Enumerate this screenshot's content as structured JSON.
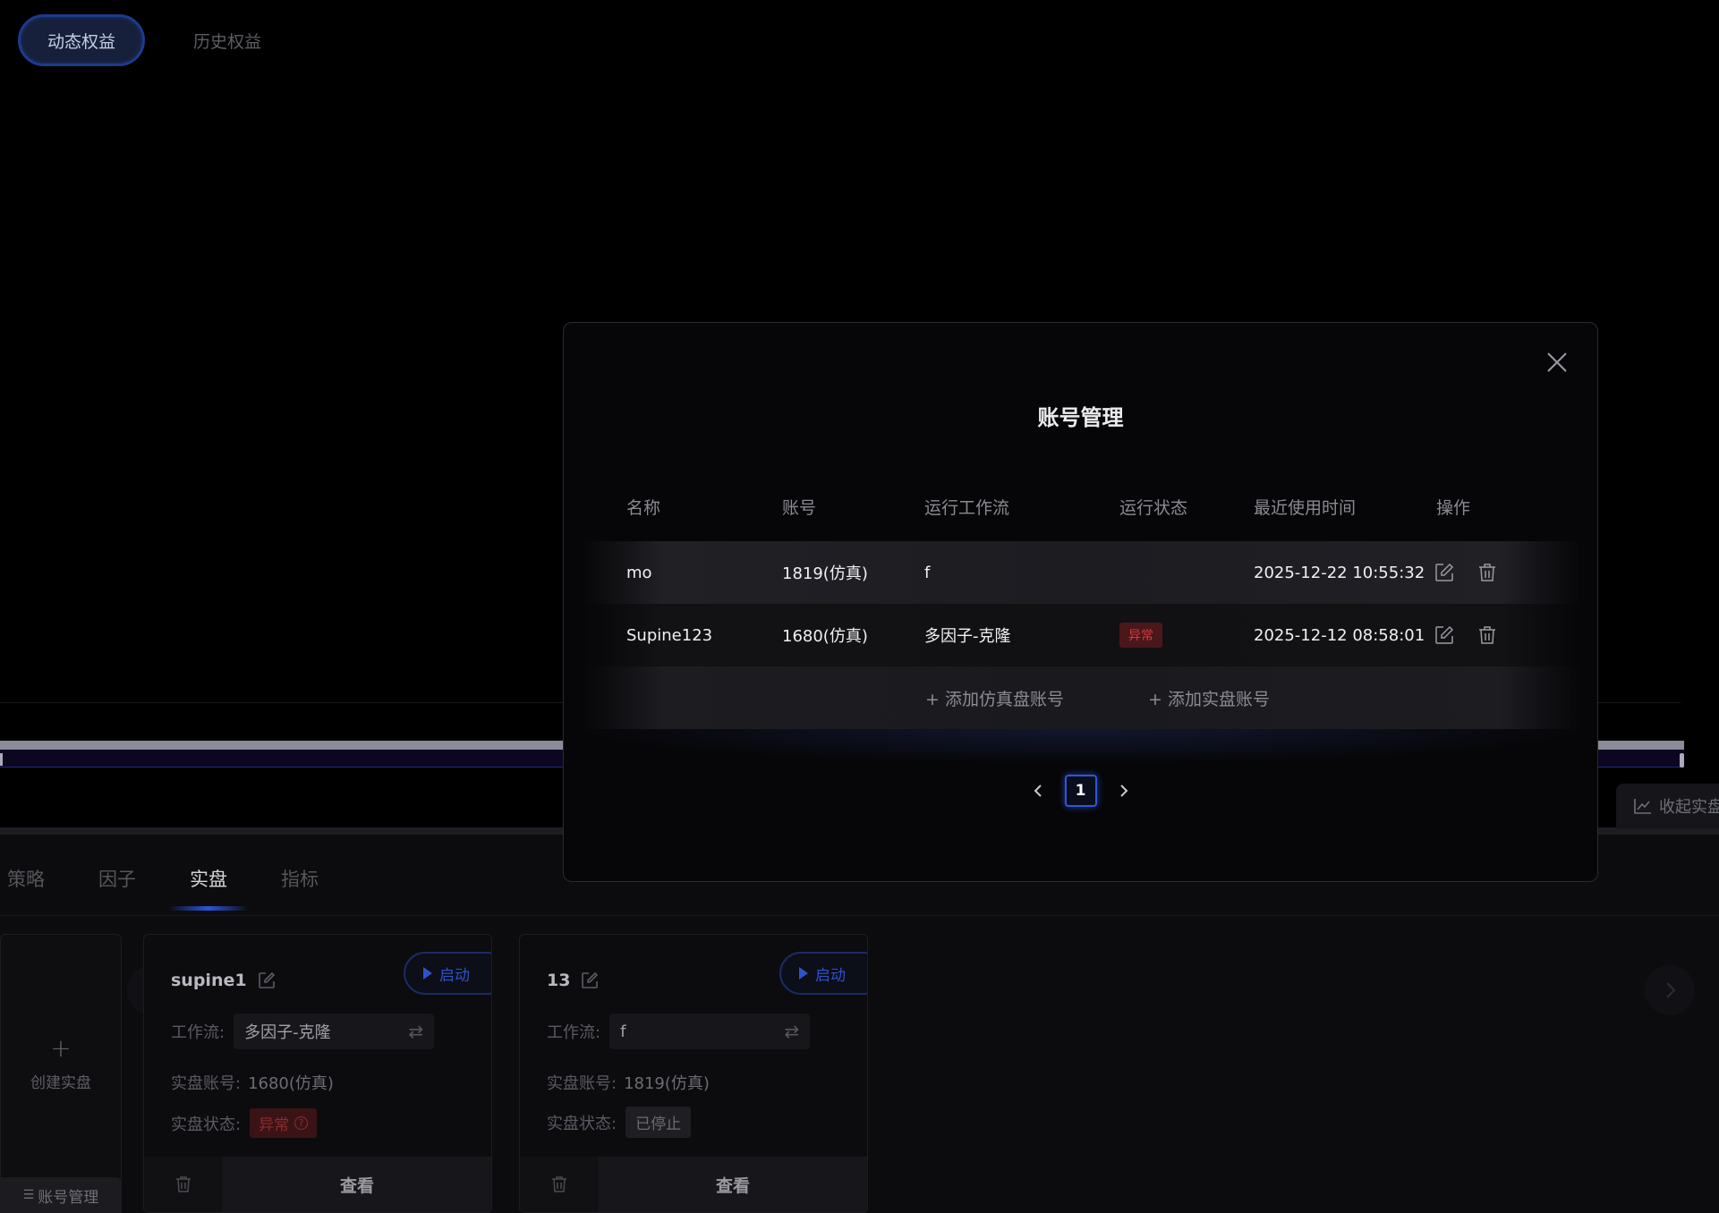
{
  "top_tabs": [
    {
      "label": "动态权益",
      "active": true
    },
    {
      "label": "历史权益",
      "active": false
    }
  ],
  "sub_tabs": [
    {
      "label": "策略",
      "active": false
    },
    {
      "label": "因子",
      "active": false
    },
    {
      "label": "实盘",
      "active": true
    },
    {
      "label": "指标",
      "active": false
    }
  ],
  "create_card": {
    "plus": "+",
    "label": "创建实盘"
  },
  "account_button": {
    "icon": "list-icon",
    "label": "账号管理"
  },
  "collapse_button": {
    "label": "收起实盘",
    "icon": "line-chart-icon"
  },
  "cards": [
    {
      "name": "supine1",
      "start_label": "启动",
      "workflow_label": "工作流:",
      "workflow_value": "多因子-克隆",
      "account_label": "实盘账号:",
      "account_value": "1680(仿真)",
      "status_label": "实盘状态:",
      "status_value": "异常",
      "status_type": "error",
      "view_label": "查看"
    },
    {
      "name": "13",
      "start_label": "启动",
      "workflow_label": "工作流:",
      "workflow_value": "f",
      "account_label": "实盘账号:",
      "account_value": "1819(仿真)",
      "status_label": "实盘状态:",
      "status_value": "已停止",
      "status_type": "stopped",
      "view_label": "查看"
    }
  ],
  "modal": {
    "title": "账号管理",
    "columns": [
      "名称",
      "账号",
      "运行工作流",
      "运行状态",
      "最近使用时间",
      "操作"
    ],
    "rows": [
      {
        "name": "mo",
        "account": "1819(仿真)",
        "workflow": "f",
        "status": "",
        "last_used": "2025-12-22 10:55:32"
      },
      {
        "name": "Supine123",
        "account": "1680(仿真)",
        "workflow": "多因子-克隆",
        "status": "异常",
        "last_used": "2025-12-12 08:58:01"
      }
    ],
    "add_sim_label": "+ 添加仿真盘账号",
    "add_live_label": "+ 添加实盘账号",
    "pagination": {
      "current_page": "1"
    }
  },
  "colors": {
    "accent": "#2f56d8",
    "error_text": "#d43a3a",
    "error_bg": "#4a181b",
    "background": "#000000"
  }
}
